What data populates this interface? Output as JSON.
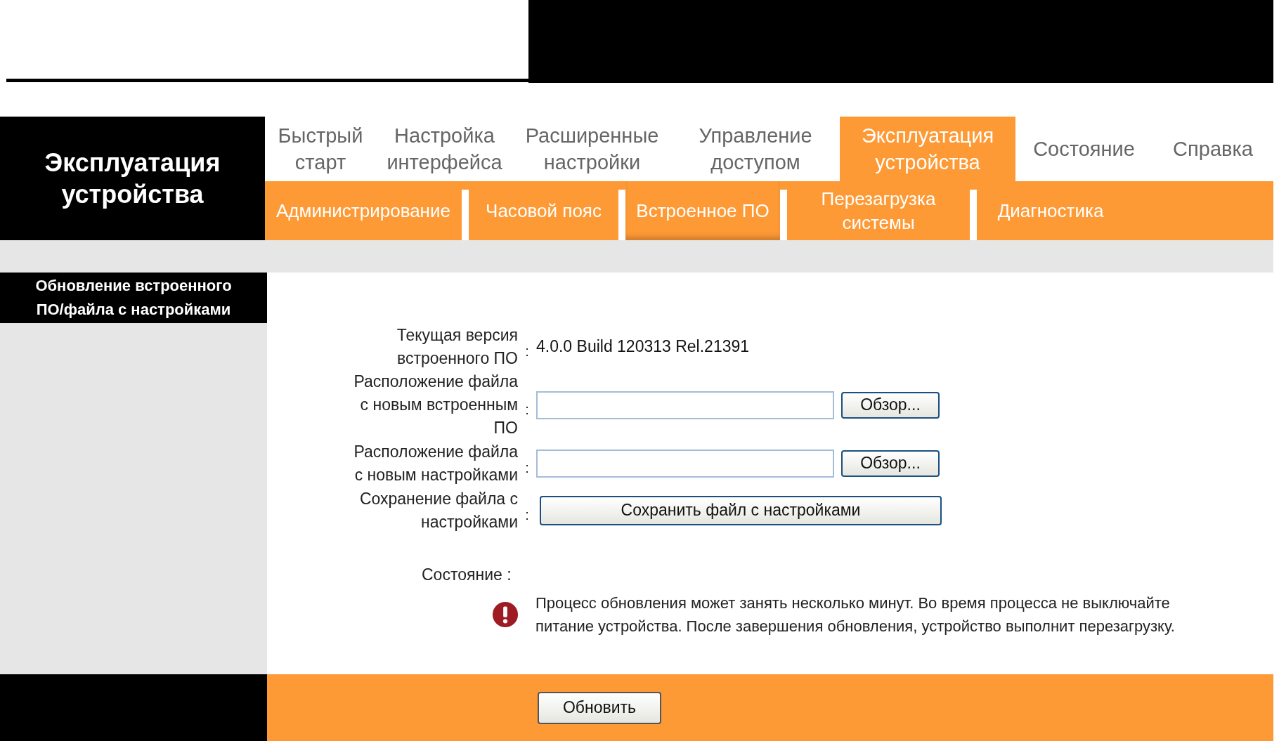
{
  "logo": {
    "title": "Эксплуатация устройства"
  },
  "main_tabs": [
    {
      "label": "Быстрый старт",
      "selected": false
    },
    {
      "label": "Настройка интерфейса",
      "selected": false
    },
    {
      "label": "Расширенные настройки",
      "selected": false
    },
    {
      "label": "Управление доступом",
      "selected": false
    },
    {
      "label": "Эксплуатация устройства",
      "selected": true
    },
    {
      "label": "Состояние",
      "selected": false
    },
    {
      "label": "Справка",
      "selected": false
    }
  ],
  "sub_tabs": [
    {
      "label": "Администрирование",
      "selected": false
    },
    {
      "label": "Часовой пояс",
      "selected": false
    },
    {
      "label": "Встроенное ПО",
      "selected": true
    },
    {
      "label": "Перезагрузка системы",
      "selected": false
    },
    {
      "label": "Диагностика",
      "selected": false
    }
  ],
  "sidebar": {
    "title": "Обновление встроенного ПО/файла с настройками"
  },
  "form": {
    "rows": [
      {
        "kind": "text",
        "label": "Текущая версия встроенного ПО",
        "colon": ":",
        "value": "4.0.0 Build 120313 Rel.21391"
      },
      {
        "kind": "file",
        "label": "Расположение файла с новым встроенным ПО",
        "colon": ":",
        "button": "Обзор..."
      },
      {
        "kind": "file",
        "label": "Расположение файла с новым настройками",
        "colon": ":",
        "button": "Обзор..."
      },
      {
        "kind": "button",
        "label": "Сохранение файла с настройками",
        "colon": ":",
        "button": "Сохранить файл с настройками"
      }
    ],
    "status_label": "Состояние :",
    "message": "Процесс обновления может занять несколько минут. Во время процесса не выключайте питание устройства. После завершения обновления, устройство выполнит перезагрузку."
  },
  "footer": {
    "button": "Обновить"
  }
}
